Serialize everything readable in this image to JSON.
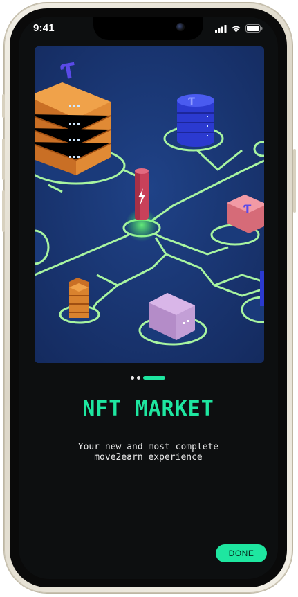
{
  "status_bar": {
    "time": "9:41",
    "icons": [
      "signal-icon",
      "wifi-icon",
      "battery-icon"
    ]
  },
  "onboarding": {
    "hero_image": "isometric-nft-blockchain-illustration",
    "pager": {
      "total": 3,
      "active": 3
    },
    "title": "NFT MARKET",
    "subtitle": "Your new and most complete\nmove2earn experience",
    "done_label": "DONE"
  },
  "colors": {
    "accent": "#1ee6a0",
    "background": "#0d0f10",
    "hero_background": "#17326b",
    "circuit_lines": "#a8f5a0"
  }
}
